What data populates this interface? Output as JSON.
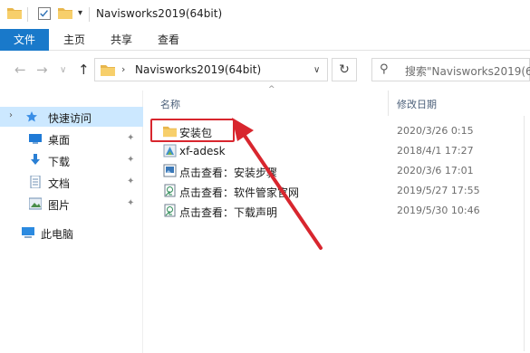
{
  "window": {
    "title": "Navisworks2019(64bit)"
  },
  "ribbon": {
    "tabs": [
      "文件",
      "主页",
      "共享",
      "查看"
    ]
  },
  "address": {
    "path": "Navisworks2019(64bit)"
  },
  "search": {
    "placeholder": "搜索\"Navisworks2019(64"
  },
  "sidebar": {
    "items": [
      {
        "label": "快速访问",
        "icon": "star-icon"
      },
      {
        "label": "桌面",
        "icon": "desktop-icon"
      },
      {
        "label": "下载",
        "icon": "download-icon"
      },
      {
        "label": "文档",
        "icon": "document-icon"
      },
      {
        "label": "图片",
        "icon": "picture-icon"
      },
      {
        "label": "此电脑",
        "icon": "computer-icon"
      }
    ]
  },
  "columns": {
    "name": "名称",
    "modified": "修改日期"
  },
  "files": [
    {
      "name": "安装包",
      "date": "2020/3/26 0:15",
      "icon": "folder-icon"
    },
    {
      "name": "xf-adesk",
      "date": "2018/4/1 17:27",
      "icon": "app-icon"
    },
    {
      "name": "点击查看：安装步骤",
      "date": "2020/3/6 17:01",
      "icon": "image-file-icon"
    },
    {
      "name": "点击查看：软件管家官网",
      "date": "2019/5/27 17:55",
      "icon": "link-file-icon"
    },
    {
      "name": "点击查看：下载声明",
      "date": "2019/5/30 10:46",
      "icon": "link-file-icon"
    }
  ],
  "colors": {
    "accent": "#1979ca",
    "selection": "#cce8ff",
    "annotation": "#d8262e"
  }
}
